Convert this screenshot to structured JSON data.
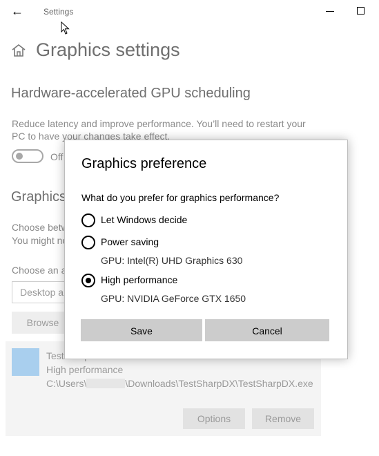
{
  "titlebar": {
    "back_icon": "←",
    "app_title": "Settings",
    "minimize_glyph": "—",
    "maximize_glyph": "□"
  },
  "page": {
    "home_icon": "home-icon",
    "title": "Graphics settings",
    "hags_heading": "Hardware-accelerated GPU scheduling",
    "hags_desc_line1": "Reduce latency and improve performance. You’ll need to restart your",
    "hags_desc_line2": "PC to have your changes take effect.",
    "toggle_state": "Off",
    "perf_heading_partial": "Graphics",
    "perf_desc_line1_partial": "Choose betw",
    "perf_desc_line2_partial": "You might no",
    "choose_app_partial": "Choose an a",
    "app_type_partial": "Desktop a",
    "browse_label": "Browse",
    "app_item": {
      "name_partial": "TestSharpD",
      "preference": "High performance",
      "path_prefix": "C:\\Users\\",
      "path_suffix": "\\Downloads\\TestSharpDX\\TestSharpDX.exe"
    },
    "options_label": "Options",
    "remove_label": "Remove"
  },
  "dialog": {
    "title": "Graphics preference",
    "question": "What do you prefer for graphics performance?",
    "options": [
      {
        "label": "Let Windows decide",
        "detail": "",
        "selected": false
      },
      {
        "label": "Power saving",
        "detail": "GPU: Intel(R) UHD Graphics 630",
        "selected": false
      },
      {
        "label": "High performance",
        "detail": "GPU: NVIDIA GeForce GTX 1650",
        "selected": true
      }
    ],
    "save_label": "Save",
    "cancel_label": "Cancel"
  }
}
